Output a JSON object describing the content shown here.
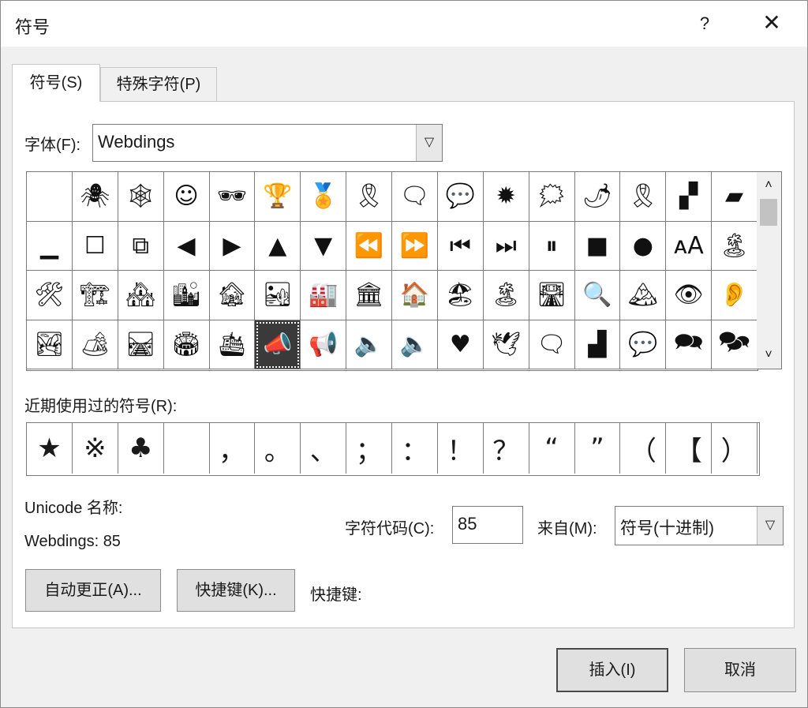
{
  "window": {
    "title": "符号",
    "help_label": "?",
    "close_label": "✕"
  },
  "tabs": [
    {
      "label": "符号(S)",
      "active": true
    },
    {
      "label": "特殊字符(P)",
      "active": false
    }
  ],
  "font": {
    "label": "字体(F):",
    "value": "Webdings"
  },
  "symbol_grid": {
    "columns": 16,
    "selected_index": 53,
    "cells": [
      "",
      "🕷",
      "🕸",
      "☺",
      "🕶",
      "🏆",
      "🏅",
      "🎗",
      "🗨",
      "💬",
      "✹",
      "🗯",
      "🌶",
      "🎗",
      "▞",
      "▰",
      "▁",
      "☐",
      "⧉",
      "◀",
      "▶",
      "▲",
      "▼",
      "⏪",
      "⏩",
      "⏮",
      "⏭",
      "⏸",
      "■",
      "●",
      "ᴀA",
      "🏝",
      "🛠",
      "🏗",
      "🏘",
      "🏙",
      "🏚",
      "🏜",
      "🏭",
      "🏛",
      "🏠",
      "🏖",
      "🏝",
      "🛣",
      "🔍",
      "🏔",
      "👁",
      "👂",
      "🏞",
      "🏕",
      "🛤",
      "🏟",
      "🛳",
      "📣",
      "📢",
      "🔈",
      "🔈",
      "♥",
      "🕊",
      "🗨",
      "▟",
      "💬",
      "🗪",
      "🗫"
    ]
  },
  "scrollbar": {
    "up_label": "˄",
    "down_label": "˅"
  },
  "recent": {
    "label": "近期使用过的符号(R):",
    "items": [
      "★",
      "※",
      "♣",
      "",
      "，",
      "。",
      "、",
      "；",
      "：",
      "！",
      "？",
      "“",
      "”",
      "（",
      "【",
      "）"
    ]
  },
  "unicode": {
    "name_label": "Unicode 名称:",
    "name_value": "Webdings: 85"
  },
  "char_code": {
    "label": "字符代码(C):",
    "value": "85"
  },
  "from": {
    "label": "来自(M):",
    "value": "符号(十进制)"
  },
  "buttons": {
    "autocorrect": "自动更正(A)...",
    "shortcut_key": "快捷键(K)...",
    "shortcut_label": "快捷键:",
    "insert": "插入(I)",
    "cancel": "取消"
  }
}
